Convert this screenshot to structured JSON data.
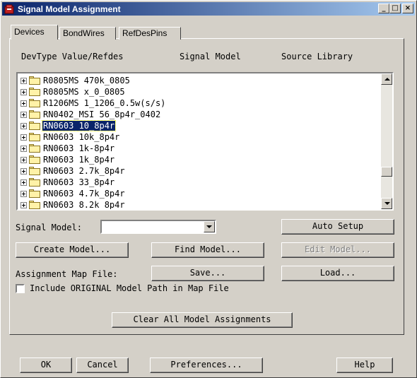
{
  "window": {
    "title": "Signal Model Assignment",
    "minimize": "_",
    "maximize": "□",
    "close": "×"
  },
  "tabs": [
    {
      "label": "Devices",
      "active": true
    },
    {
      "label": "BondWires",
      "active": false
    },
    {
      "label": "RefDesPins",
      "active": false
    }
  ],
  "columns": {
    "devtype": "DevType Value/Refdes",
    "signal_model": "Signal Model",
    "source_library": "Source Library"
  },
  "devices": [
    {
      "label": "R0805MS 470k_0805",
      "selected": false
    },
    {
      "label": "R0805MS x_0_0805",
      "selected": false
    },
    {
      "label": "R1206MS 1_1206_0.5w(s/s)",
      "selected": false
    },
    {
      "label": "RN0402_MSI 56_8p4r_0402",
      "selected": false
    },
    {
      "label": "RN0603 10_8p4r",
      "selected": true
    },
    {
      "label": "RN0603 10k_8p4r",
      "selected": false
    },
    {
      "label": "RN0603 1k-8p4r",
      "selected": false
    },
    {
      "label": "RN0603 1k_8p4r",
      "selected": false
    },
    {
      "label": "RN0603 2.7k_8p4r",
      "selected": false
    },
    {
      "label": "RN0603 33_8p4r",
      "selected": false
    },
    {
      "label": "RN0603 4.7k_8p4r",
      "selected": false
    },
    {
      "label": "RN0603 8.2k_8p4r",
      "selected": false
    }
  ],
  "signal_model": {
    "label": "Signal Model:",
    "value": ""
  },
  "buttons": {
    "auto_setup": "Auto Setup",
    "create_model": "Create Model...",
    "find_model": "Find Model...",
    "edit_model": "Edit Model...",
    "save": "Save...",
    "load": "Load...",
    "clear_all": "Clear All Model Assignments",
    "ok": "OK",
    "cancel": "Cancel",
    "preferences": "Preferences...",
    "help": "Help"
  },
  "assignment_map": {
    "label": "Assignment Map File:"
  },
  "include_path": {
    "label": "Include ORIGINAL Model Path in Map File",
    "checked": false
  },
  "colors": {
    "title_start": "#0a246a",
    "title_end": "#a6caf0",
    "selection": "#0a246a",
    "face": "#d4d0c8"
  }
}
